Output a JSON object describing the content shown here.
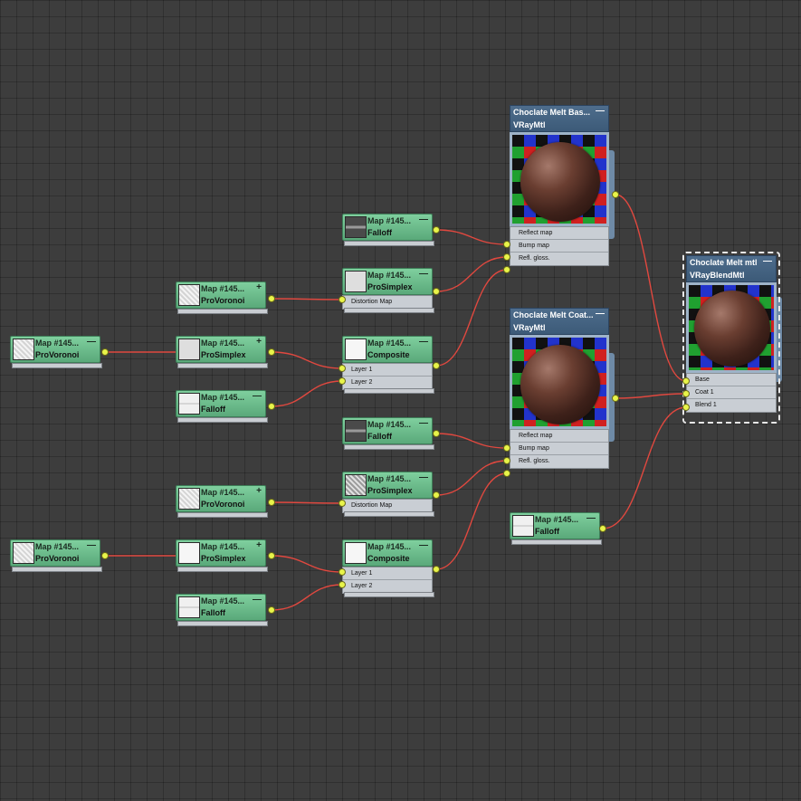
{
  "nodes": {
    "base_mtl": {
      "title": "Choclate Melt Bas...",
      "type": "VRayMtl",
      "corner": "—",
      "slots": [
        "Reflect map",
        "Bump map",
        "Refl. gloss."
      ]
    },
    "coat_mtl": {
      "title": "Choclate Melt Coat...",
      "type": "VRayMtl",
      "corner": "—",
      "slots": [
        "Reflect map",
        "Bump map",
        "Refl. gloss."
      ]
    },
    "blend_mtl": {
      "title": "Choclate Melt mtl",
      "type": "VRayBlendMtl",
      "corner": "—",
      "slots": [
        "Base",
        "Coat 1",
        "Blend 1"
      ]
    },
    "falloff_a": {
      "title": "Map #145...",
      "type": "Falloff",
      "corner": "—"
    },
    "prosimplex_a": {
      "title": "Map #145...",
      "type": "ProSimplex",
      "corner": "—",
      "slots": [
        "Distortion Map"
      ]
    },
    "provoronoi_a": {
      "title": "Map #145...",
      "type": "ProVoronoi",
      "corner": "+"
    },
    "composite_a": {
      "title": "Map #145...",
      "type": "Composite",
      "corner": "—",
      "slots": [
        "Layer 1",
        "Layer 2"
      ]
    },
    "provoronoi_far_a": {
      "title": "Map #145...",
      "type": "ProVoronoi",
      "corner": "—"
    },
    "prosimplex_mid_a": {
      "title": "Map #145...",
      "type": "ProSimplex",
      "corner": "+"
    },
    "falloff_layer_a": {
      "title": "Map #145...",
      "type": "Falloff",
      "corner": "—"
    },
    "falloff_b": {
      "title": "Map #145...",
      "type": "Falloff",
      "corner": "—"
    },
    "prosimplex_b": {
      "title": "Map #145...",
      "type": "ProSimplex",
      "corner": "—",
      "slots": [
        "Distortion Map"
      ]
    },
    "provoronoi_b": {
      "title": "Map #145...",
      "type": "ProVoronoi",
      "corner": "+"
    },
    "composite_b": {
      "title": "Map #145...",
      "type": "Composite",
      "corner": "—",
      "slots": [
        "Layer 1",
        "Layer 2"
      ]
    },
    "provoronoi_far_b": {
      "title": "Map #145...",
      "type": "ProVoronoi",
      "corner": "—"
    },
    "prosimplex_mid_b": {
      "title": "Map #145...",
      "type": "ProSimplex",
      "corner": "+"
    },
    "falloff_layer_b": {
      "title": "Map #145...",
      "type": "Falloff",
      "corner": "—"
    },
    "falloff_blend": {
      "title": "Map #145...",
      "type": "Falloff",
      "corner": "—"
    }
  },
  "colors": {
    "wire": "#e0483f",
    "port": "#e8f44a",
    "map_node": "#6fbf8c",
    "mtl_header": "#4a6a8a"
  }
}
